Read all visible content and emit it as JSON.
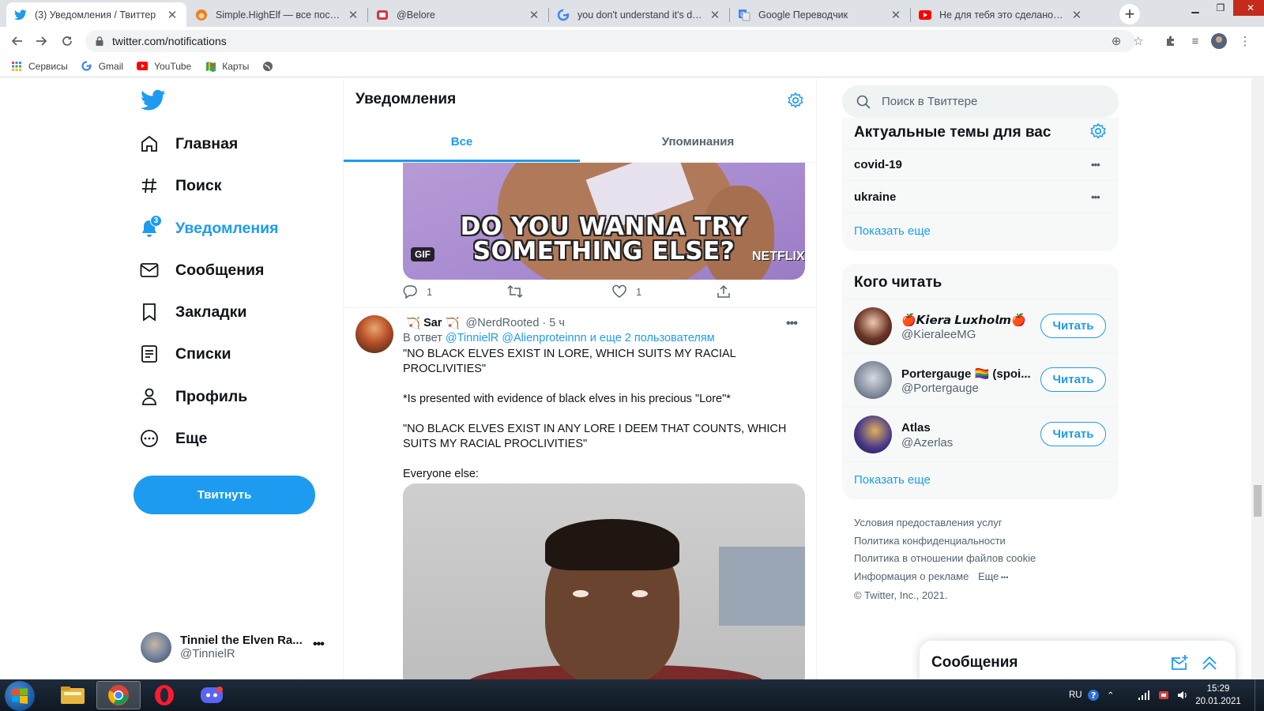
{
  "browser": {
    "tabs": [
      {
        "title": "(3) Уведомления / Твиттер",
        "icon": "twitter-bird-icon",
        "active": true
      },
      {
        "title": "Simple.HighElf — все посты по...",
        "icon": "fox-icon"
      },
      {
        "title": "@Belore",
        "icon": "discord-like-icon"
      },
      {
        "title": "you don't understand it's differe...",
        "icon": "google-g-icon"
      },
      {
        "title": "Google Переводчик",
        "icon": "google-translate-icon"
      },
      {
        "title": "Не для тебя это сделано - You...",
        "icon": "youtube-icon"
      }
    ],
    "url": "twitter.com/notifications",
    "bookmarks": [
      {
        "label": "Сервисы",
        "icon": "apps-grid-icon"
      },
      {
        "label": "Gmail",
        "icon": "google-g-icon"
      },
      {
        "label": "YouTube",
        "icon": "youtube-icon"
      },
      {
        "label": "Карты",
        "icon": "maps-pin-icon"
      },
      {
        "label": "",
        "icon": "globe-icon"
      }
    ]
  },
  "twitter": {
    "nav": [
      {
        "label": "Главная",
        "icon": "home-icon"
      },
      {
        "label": "Поиск",
        "icon": "hashtag-icon"
      },
      {
        "label": "Уведомления",
        "icon": "bell-icon",
        "active": true,
        "badge": "3"
      },
      {
        "label": "Сообщения",
        "icon": "mail-icon"
      },
      {
        "label": "Закладки",
        "icon": "bookmark-icon"
      },
      {
        "label": "Списки",
        "icon": "list-icon"
      },
      {
        "label": "Профиль",
        "icon": "person-icon"
      },
      {
        "label": "Еще",
        "icon": "more-circle-icon"
      }
    ],
    "tweet_button": "Твитнуть",
    "account": {
      "name": "Tinniel the Elven Ra...",
      "handle": "@TinnielR"
    },
    "header": {
      "title": "Уведомления"
    },
    "tabs": [
      "Все",
      "Упоминания"
    ],
    "media1": {
      "caption_line1": "DO YOU WANNA TRY",
      "caption_line2": "SOMETHING ELSE?",
      "gif_badge": "GIF",
      "watermark": "NETFLIX"
    },
    "actions1": {
      "replies": "1",
      "retweets": "",
      "likes": "1"
    },
    "tweet": {
      "name": "Sar",
      "name_emoji": "🏹",
      "handle": "@NerdRooted",
      "time": "· 5 ч",
      "reply_prefix": "В ответ",
      "reply_to": "@TinnielR @Alienproteinnn",
      "reply_suffix": " и еще 2 пользователям",
      "paragraphs": [
        "\"NO BLACK ELVES EXIST IN LORE, WHICH SUITS MY RACIAL PROCLIVITIES\"",
        "*Is presented with evidence of black elves in his precious \"Lore\"*",
        "\"NO BLACK ELVES EXIST IN ANY LORE I DEEM THAT COUNTS, WHICH SUITS MY RACIAL PROCLIVITIES\"",
        "Everyone else:"
      ]
    },
    "search_placeholder": "Поиск в Твиттере",
    "trends": {
      "title": "Актуальные темы для вас",
      "items": [
        "covid-19",
        "ukraine"
      ],
      "show_more": "Показать еще"
    },
    "who_to_follow": {
      "title": "Кого читать",
      "items": [
        {
          "name": "🍎𝙆𝙞𝙚𝙧𝙖 𝙇𝙪𝙭𝙝𝙤𝙡𝙢🍎",
          "handle": "@KieraleeMG",
          "button": "Читать"
        },
        {
          "name": "Portergauge 🏳️‍🌈 (spoi...",
          "handle": "@Portergauge",
          "button": "Читать"
        },
        {
          "name": "Atlas",
          "handle": "@Azerlas",
          "button": "Читать"
        }
      ],
      "show_more": "Показать еще"
    },
    "footer": [
      "Условия предоставления услуг",
      "Политика конфиденциальности",
      "Политика в отношении файлов cookie",
      "Информация о рекламе",
      "Еще",
      "© Twitter, Inc., 2021."
    ],
    "dm_drawer": {
      "title": "Сообщения"
    }
  },
  "taskbar": {
    "lang": "RU",
    "time": "15:29",
    "date": "20.01.2021",
    "apps": [
      "explorer-icon",
      "chrome-icon",
      "opera-icon",
      "discord-icon"
    ]
  },
  "colors": {
    "accent": "#1d9bf0",
    "text": "#0f1419",
    "muted": "#536471",
    "panel": "#f7f9f9"
  }
}
